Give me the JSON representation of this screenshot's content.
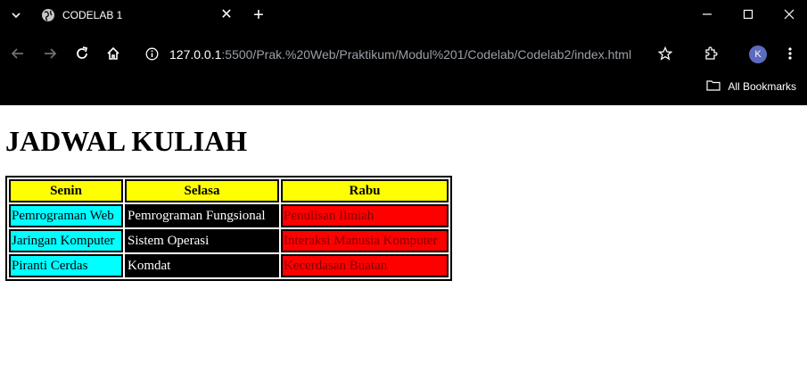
{
  "browser": {
    "tab_title": "CODELAB 1",
    "url_host": "127.0.0.1",
    "url_rest": ":5500/Prak.%20Web/Praktikum/Modul%201/Codelab/Codelab2/index.html",
    "profile_initial": "K",
    "bookmarks_label": "All Bookmarks"
  },
  "page": {
    "heading": "JADWAL KULIAH"
  },
  "table": {
    "headers": [
      "Senin",
      "Selasa",
      "Rabu"
    ],
    "rows": [
      [
        "Pemrograman Web",
        "Pemrograman Fungsional",
        "Penulisan Ilmiah"
      ],
      [
        "Jaringan Komputer",
        "Sistem Operasi",
        "Interaksi Manusia Komputer"
      ],
      [
        "Piranti Cerdas",
        "Komdat",
        "Kecerdasan Buatan"
      ]
    ]
  },
  "colors": {
    "header_bg": "#ffff00",
    "senin_bg": "#00ffff",
    "selasa_bg": "#000000",
    "rabu_bg": "#ff0000"
  }
}
